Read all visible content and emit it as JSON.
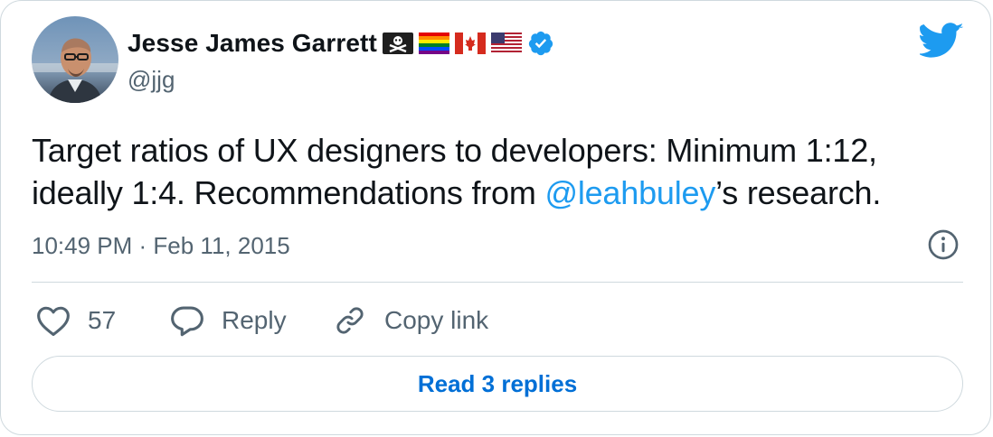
{
  "author": {
    "display_name": "Jesse James Garrett",
    "handle": "@jjg",
    "emoji_flags": [
      "pirate-flag",
      "rainbow-flag",
      "canada-flag",
      "usa-flag"
    ],
    "verified": true
  },
  "tweet": {
    "text_before": "Target ratios of UX designers to developers: Minimum 1:12, ideally 1:4. Recommendations from ",
    "mention": "@leahbuley",
    "text_after": "’s research.",
    "timestamp": "10:49 PM · Feb 11, 2015"
  },
  "actions": {
    "like_count": "57",
    "reply_label": "Reply",
    "copy_label": "Copy link"
  },
  "read_replies_label": "Read 3 replies",
  "colors": {
    "accent": "#1d9bf0",
    "link_button": "#006fd6",
    "secondary_text": "#536471",
    "border": "#cfd9de"
  },
  "icons": [
    "twitter-bird-icon",
    "verified-badge-icon",
    "info-icon",
    "heart-icon",
    "reply-bubble-icon",
    "link-icon"
  ]
}
